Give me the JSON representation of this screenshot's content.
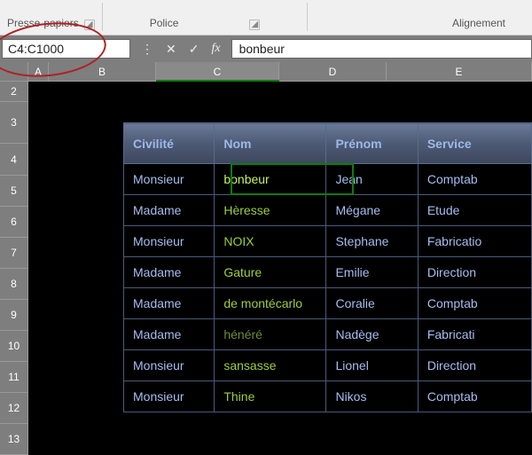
{
  "ribbon": {
    "groups": [
      "Presse-papiers",
      "Police",
      "Alignement"
    ]
  },
  "formula_bar": {
    "name_box": "C4:C1000",
    "cancel_glyph": "✕",
    "confirm_glyph": "✓",
    "fx_label": "fx",
    "value": "bonbeur"
  },
  "columns": [
    "A",
    "B",
    "C",
    "D",
    "E"
  ],
  "active_column": "C",
  "visible_rows": [
    {
      "n": 2,
      "h": 23
    },
    {
      "n": 3,
      "h": 47
    },
    {
      "n": 4,
      "h": 36
    },
    {
      "n": 5,
      "h": 35
    },
    {
      "n": 6,
      "h": 35
    },
    {
      "n": 7,
      "h": 35
    },
    {
      "n": 8,
      "h": 35
    },
    {
      "n": 9,
      "h": 35
    },
    {
      "n": 10,
      "h": 35
    },
    {
      "n": 11,
      "h": 35
    },
    {
      "n": 12,
      "h": 35
    },
    {
      "n": 13,
      "h": 35
    }
  ],
  "table": {
    "headers": [
      "Civilité",
      "Nom",
      "Prénom",
      "Service"
    ],
    "rows": [
      {
        "civ": "Monsieur",
        "nom": "bonbeur",
        "prenom": "Jean",
        "service": "Comptab"
      },
      {
        "civ": "Madame",
        "nom": "Hèresse",
        "prenom": "Mégane",
        "service": "Etude"
      },
      {
        "civ": "Monsieur",
        "nom": "NOIX",
        "prenom": "Stephane",
        "service": "Fabricatio"
      },
      {
        "civ": "Madame",
        "nom": "Gature",
        "prenom": "Emilie",
        "service": "Direction"
      },
      {
        "civ": "Madame",
        "nom": "de montécarlo",
        "prenom": "Coralie",
        "service": "Comptab"
      },
      {
        "civ": "Madame",
        "nom": "hénéré",
        "prenom": "Nadège",
        "service": "Fabricati"
      },
      {
        "civ": "Monsieur",
        "nom": "sansasse",
        "prenom": "Lionel",
        "service": "Direction"
      },
      {
        "civ": "Monsieur",
        "nom": "Thine",
        "prenom": "Nikos",
        "service": "Comptab"
      }
    ]
  }
}
